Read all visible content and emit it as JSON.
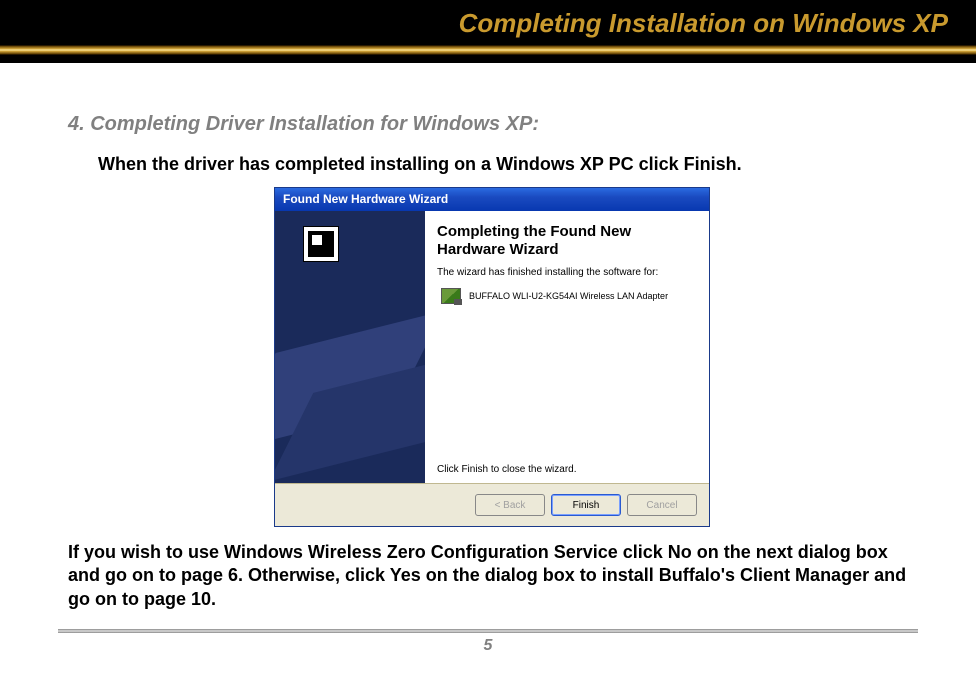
{
  "header": {
    "title": "Completing Installation on Windows XP"
  },
  "section": {
    "heading": "4. Completing Driver Installation for Windows XP:",
    "step1": "When the driver has completed installing on a Windows XP PC click Finish.",
    "follow": "If you wish to use Windows Wireless Zero Configuration Service click No on the next dialog box and go on to page 6. Otherwise, click Yes on the dialog box to install Buffalo's Client Manager and go on to page 10."
  },
  "dialog": {
    "titlebar": "Found New Hardware Wizard",
    "heading": "Completing the Found New Hardware Wizard",
    "subtext": "The wizard has finished installing the software for:",
    "device": "BUFFALO WLI-U2-KG54AI   Wireless LAN Adapter",
    "closing": "Click Finish to close the wizard.",
    "buttons": {
      "back": "< Back",
      "finish": "Finish",
      "cancel": "Cancel"
    }
  },
  "page": {
    "number": "5"
  }
}
